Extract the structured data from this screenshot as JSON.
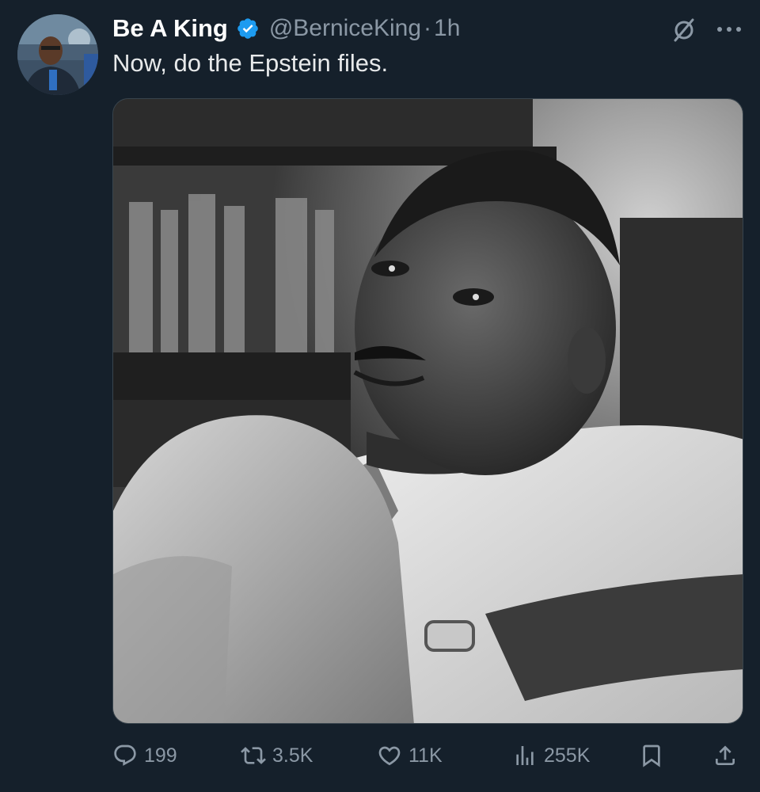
{
  "tweet": {
    "display_name": "Be A King",
    "verified": true,
    "handle": "@BerniceKing",
    "separator": "·",
    "time": "1h",
    "text": "Now, do the Epstein files.",
    "media": {
      "type": "photo",
      "style": "black-and-white portrait"
    }
  },
  "actions": {
    "reply": {
      "icon": "reply-icon",
      "count": "199"
    },
    "retweet": {
      "icon": "retweet-icon",
      "count": "3.5K"
    },
    "like": {
      "icon": "heart-icon",
      "count": "11K"
    },
    "views": {
      "icon": "views-icon",
      "count": "255K"
    },
    "bookmark": {
      "icon": "bookmark-icon"
    },
    "share": {
      "icon": "share-icon"
    }
  },
  "colors": {
    "background": "#15202b",
    "text": "#e7e9ea",
    "muted": "#8b98a5",
    "verified": "#1d9bf0"
  }
}
